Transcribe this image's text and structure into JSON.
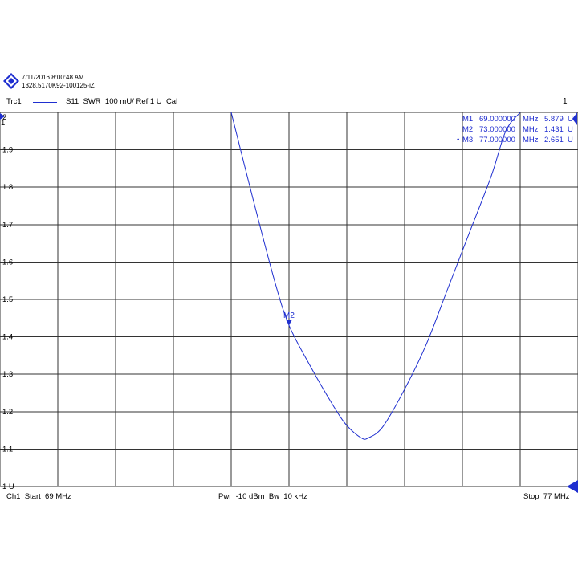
{
  "header": {
    "datetime": "7/11/2016 8:00:48 AM",
    "instrument_id": "1328.5170K92-100125-iZ"
  },
  "trace": {
    "name": "Trc1",
    "description": "S11  SWR  100 mU/ Ref 1 U  Cal",
    "channel_number": "1",
    "color": "#1f2fd0"
  },
  "footer": {
    "left": "Ch1  Start  69 MHz",
    "center": "Pwr  -10 dBm  Bw  10 kHz",
    "right": "Stop  77 MHz"
  },
  "markers": [
    {
      "label": "M1",
      "prefix": "",
      "freq": "69.000000",
      "freq_unit": "MHz",
      "value": "5.879",
      "value_unit": "U"
    },
    {
      "label": "M2",
      "prefix": "",
      "freq": "73.000000",
      "freq_unit": "MHz",
      "value": "1.431",
      "value_unit": "U"
    },
    {
      "label": "M3",
      "prefix": "•",
      "freq": "77.000000",
      "freq_unit": "MHz",
      "value": "2.651",
      "value_unit": "U"
    }
  ],
  "chart_data": {
    "type": "line",
    "title": "",
    "xlabel": "",
    "ylabel": "",
    "xlim": [
      69,
      77
    ],
    "ylim": [
      1,
      2
    ],
    "x_unit": "MHz",
    "y_unit": "U",
    "grid": true,
    "y_ticks": [
      "2",
      "1.9",
      "1.8",
      "1.7",
      "1.6",
      "1.5",
      "1.4",
      "1.3",
      "1.2",
      "1.1",
      "1 U"
    ],
    "reference_label": "1",
    "series": [
      {
        "x": [
          72.2,
          72.5,
          72.8,
          73.0,
          73.3,
          73.6,
          73.8,
          74.0,
          74.1,
          74.3,
          74.6,
          74.9,
          75.2,
          75.5,
          75.8,
          76.0,
          76.2
        ],
        "y": [
          2.0,
          1.77,
          1.55,
          1.431,
          1.32,
          1.22,
          1.163,
          1.13,
          1.13,
          1.16,
          1.26,
          1.38,
          1.53,
          1.68,
          1.83,
          1.95,
          2.0
        ]
      }
    ]
  }
}
